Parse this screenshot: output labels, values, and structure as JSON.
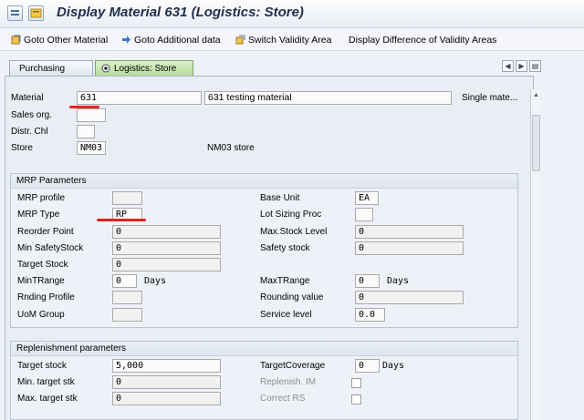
{
  "window": {
    "title": "Display Material 631 (Logistics: Store)"
  },
  "toolbar": {
    "goto_other": "Goto Other Material",
    "goto_additional": "Goto Additional data",
    "switch_validity": "Switch Validity Area",
    "display_diff": "Display Difference of Validity Areas"
  },
  "tabs": {
    "purchasing": "Purchasing",
    "logistics": "Logistics: Store"
  },
  "header": {
    "material_label": "Material",
    "material_value": "631",
    "material_desc": "631 testing material",
    "material_type": "Single mate...",
    "sales_org_label": "Sales org.",
    "sales_org_value": "",
    "distr_chl_label": "Distr. Chl",
    "distr_chl_value": "",
    "store_label": "Store",
    "store_value": "NM03",
    "store_desc": "NM03 store"
  },
  "mrp": {
    "title": "MRP Parameters",
    "mrp_profile_label": "MRP profile",
    "mrp_profile_value": "",
    "mrp_type_label": "MRP Type",
    "mrp_type_value": "RP",
    "reorder_point_label": "Reorder Point",
    "reorder_point_value": "0",
    "min_safety_label": "Min SafetyStock",
    "min_safety_value": "0",
    "target_stock_label": "Target Stock",
    "target_stock_value": "0",
    "min_trange_label": "MinTRange",
    "min_trange_value": "0",
    "min_trange_unit": "Days",
    "rnding_profile_label": "Rnding Profile",
    "rnding_profile_value": "",
    "uom_group_label": "UoM Group",
    "uom_group_value": "",
    "base_unit_label": "Base Unit",
    "base_unit_value": "EA",
    "lot_sizing_label": "Lot Sizing Proc",
    "lot_sizing_value": "",
    "max_stock_label": "Max.Stock Level",
    "max_stock_value": "0",
    "safety_stock_label": "Safety stock",
    "safety_stock_value": "0",
    "max_trange_label": "MaxTRange",
    "max_trange_value": "0",
    "max_trange_unit": "Days",
    "rounding_value_label": "Rounding value",
    "rounding_value_value": "0",
    "service_level_label": "Service level",
    "service_level_value": "0.0"
  },
  "replenishment": {
    "title": "Replenishment parameters",
    "target_stock_label": "Target stock",
    "target_stock_value": "5,000",
    "min_target_label": "Min. target stk",
    "min_target_value": "0",
    "max_target_label": "Max. target stk",
    "max_target_value": "0",
    "target_coverage_label": "TargetCoverage",
    "target_coverage_value": "0",
    "target_coverage_unit": "Days",
    "replenish_im_label": "Replenish. IM",
    "correct_rs_label": "Correct RS"
  },
  "colors": {
    "annotation_red": "#e3221d",
    "active_tab": "#b8dc9c",
    "title_text": "#1f2f4f"
  }
}
